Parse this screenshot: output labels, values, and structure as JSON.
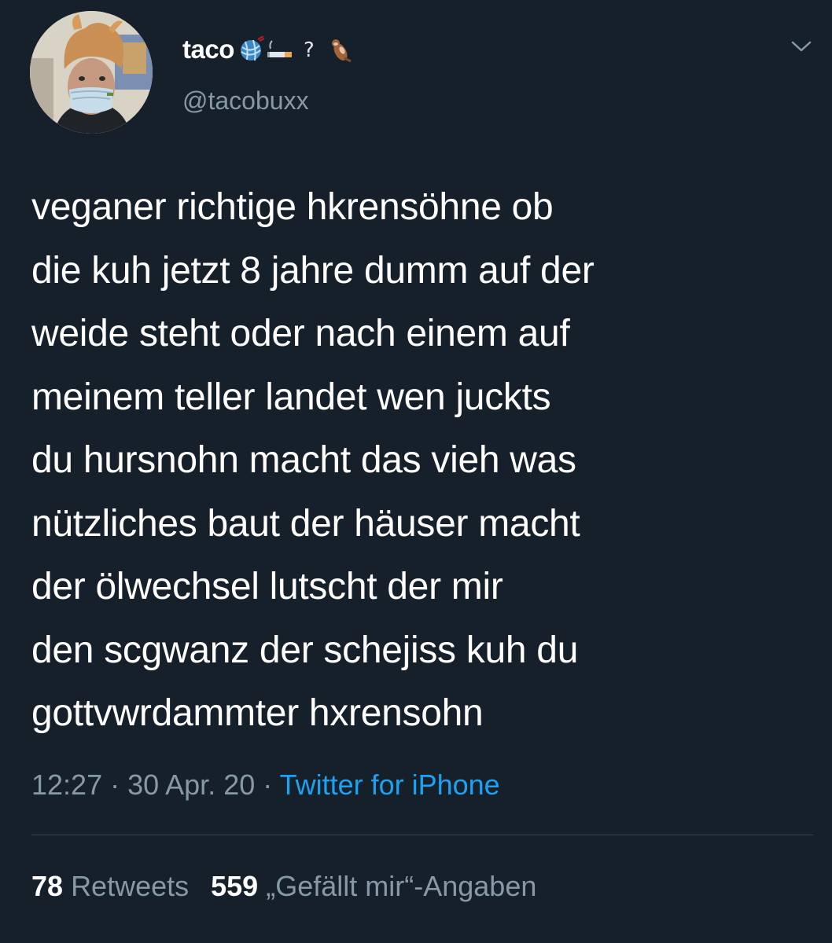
{
  "user": {
    "display_name": "taco",
    "name_emojis": [
      "yarn-ball-emoji",
      "cigarette-emoji",
      "question-mark-emoji",
      "otter-emoji"
    ],
    "handle": "@tacobuxx",
    "avatar": "profile-photo-person-with-face-mask-and-chicken-hat"
  },
  "menu": {
    "icon": "chevron-down-icon"
  },
  "tweet": {
    "lines": [
      "veganer richtige hkrensöhne ob",
      "die kuh jetzt 8 jahre dumm auf der",
      "weide steht oder nach einem auf",
      "meinem teller landet wen juckts",
      "du hursnohn macht das vieh was",
      "nützliches baut der häuser macht",
      "der ölwechsel lutscht der mir",
      "den scgwanz der schejiss kuh du",
      "gottvwrdammter hxrensohn"
    ]
  },
  "meta": {
    "time": "12:27",
    "separator": " · ",
    "date": "30 Apr. 20",
    "source": "Twitter for iPhone"
  },
  "stats": {
    "retweets_count": "78",
    "retweets_label": "Retweets",
    "likes_count": "559",
    "likes_label": "„Gefällt mir“-Angaben"
  },
  "colors": {
    "background": "#15202b",
    "text": "#ffffff",
    "secondary": "#8899a6",
    "link": "#1da1f2",
    "divider": "#38444d"
  }
}
